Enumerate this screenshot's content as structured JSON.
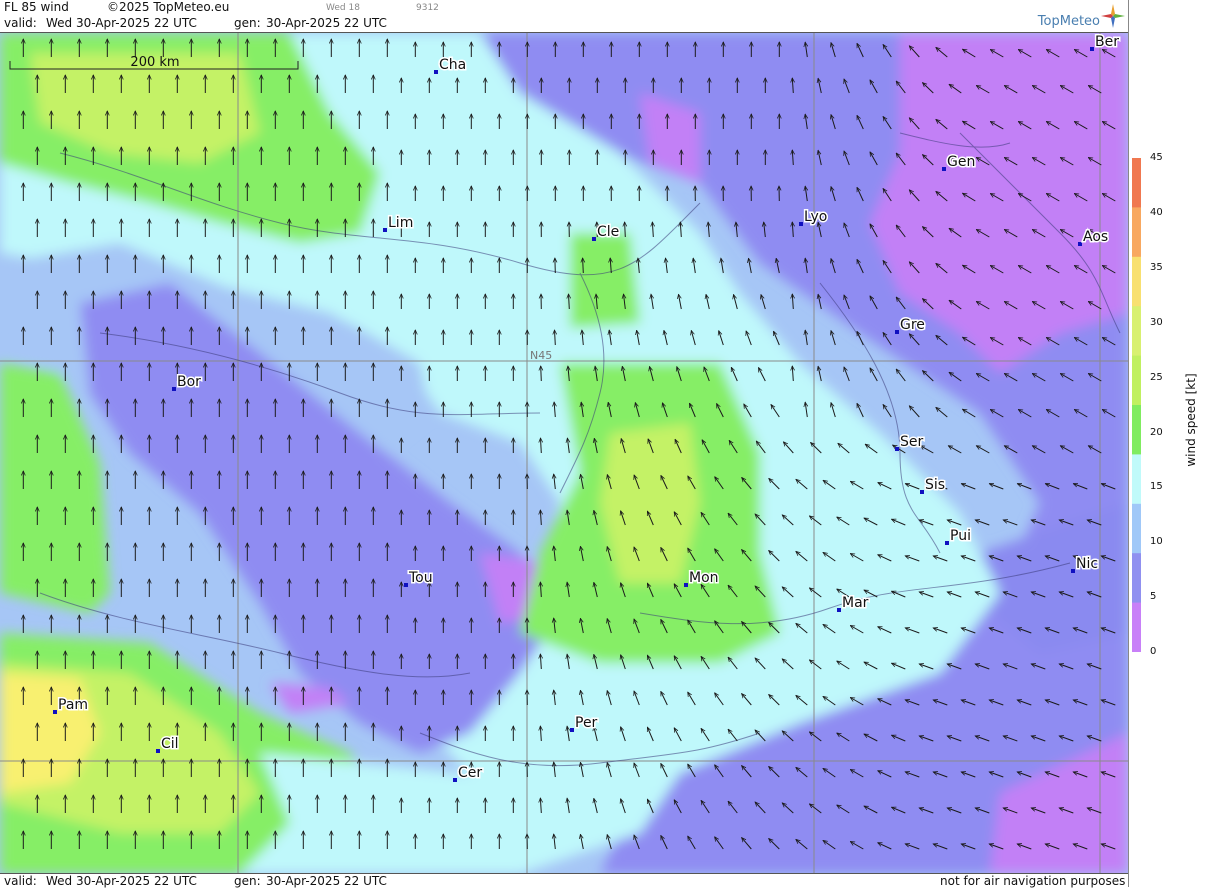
{
  "header": {
    "product": "FL 85 wind",
    "copyright": "©2025 TopMeteo.eu",
    "day_label": "Wed 18",
    "code": "9312",
    "valid_label": "valid:",
    "valid_time": "Wed  30-Apr-2025  22 UTC",
    "gen_label": "gen:",
    "gen_time": "30-Apr-2025 22 UTC",
    "logo": "TopMeteo"
  },
  "footer": {
    "valid_label": "valid:",
    "valid_time": "Wed  30-Apr-2025  22 UTC",
    "gen_label": "gen:",
    "gen_time": "30-Apr-2025 22 UTC",
    "disclaimer": "not for air navigation purposes"
  },
  "map": {
    "scale_label": "200 km",
    "graticule_label": "N45",
    "cities": [
      {
        "name": "Cha"
      },
      {
        "name": "Ber"
      },
      {
        "name": "Lim"
      },
      {
        "name": "Cle"
      },
      {
        "name": "Lyo"
      },
      {
        "name": "Gen"
      },
      {
        "name": "Aos"
      },
      {
        "name": "Gre"
      },
      {
        "name": "Bor"
      },
      {
        "name": "Ser"
      },
      {
        "name": "Sis"
      },
      {
        "name": "Pui"
      },
      {
        "name": "Tou"
      },
      {
        "name": "Mon"
      },
      {
        "name": "Nic"
      },
      {
        "name": "Mar"
      },
      {
        "name": "Pam"
      },
      {
        "name": "Per"
      },
      {
        "name": "Cil"
      },
      {
        "name": "Cer"
      }
    ]
  },
  "legend": {
    "title": "wind speed [kt]",
    "ticks": [
      "45",
      "40",
      "35",
      "30",
      "25",
      "20",
      "15",
      "10",
      "5",
      "0"
    ],
    "colors": [
      "#f07850",
      "#f8a860",
      "#f8e070",
      "#d8f070",
      "#c0f060",
      "#80ec60",
      "#c0fafa",
      "#a0c8f8",
      "#9090f0",
      "#c880f8"
    ]
  }
}
